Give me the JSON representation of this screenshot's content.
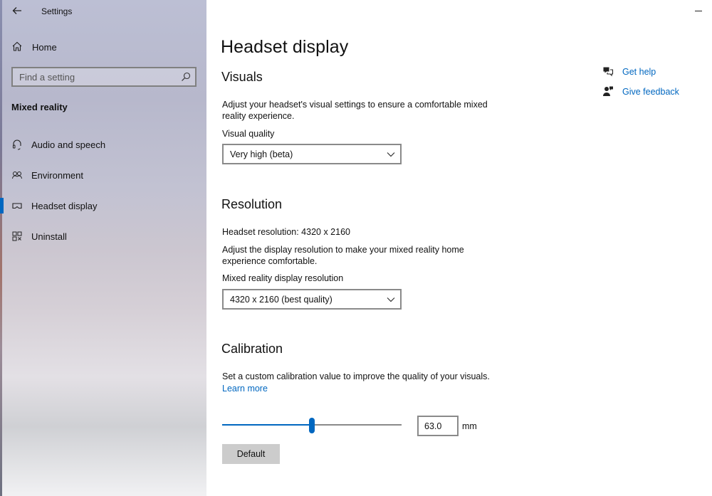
{
  "window": {
    "title": "Settings"
  },
  "sidebar": {
    "home_label": "Home",
    "search_placeholder": "Find a setting",
    "section_label": "Mixed reality",
    "items": [
      {
        "label": "Audio and speech",
        "icon": "headset-icon"
      },
      {
        "label": "Environment",
        "icon": "environment-icon"
      },
      {
        "label": "Headset display",
        "icon": "headset-display-icon",
        "selected": true
      },
      {
        "label": "Uninstall",
        "icon": "uninstall-icon"
      }
    ]
  },
  "main": {
    "page_title": "Headset display",
    "visuals": {
      "heading": "Visuals",
      "description": "Adjust your headset's visual settings to ensure a comfortable mixed reality experience.",
      "quality_label": "Visual quality",
      "quality_value": "Very high (beta)"
    },
    "resolution": {
      "heading": "Resolution",
      "headset_resolution": "Headset resolution: 4320 x 2160",
      "description": "Adjust the display resolution to make your mixed reality home experience comfortable.",
      "select_label": "Mixed reality display resolution",
      "select_value": "4320 x 2160 (best quality)"
    },
    "calibration": {
      "heading": "Calibration",
      "description": "Set a custom calibration value to improve the quality of your visuals.",
      "learn_more": "Learn more",
      "slider_fraction": 0.5,
      "value": "63.0",
      "unit": "mm",
      "default_label": "Default"
    },
    "help": {
      "get_help": "Get help",
      "give_feedback": "Give feedback"
    }
  },
  "colors": {
    "accent": "#0067c0",
    "button_gray": "#cccccc"
  }
}
